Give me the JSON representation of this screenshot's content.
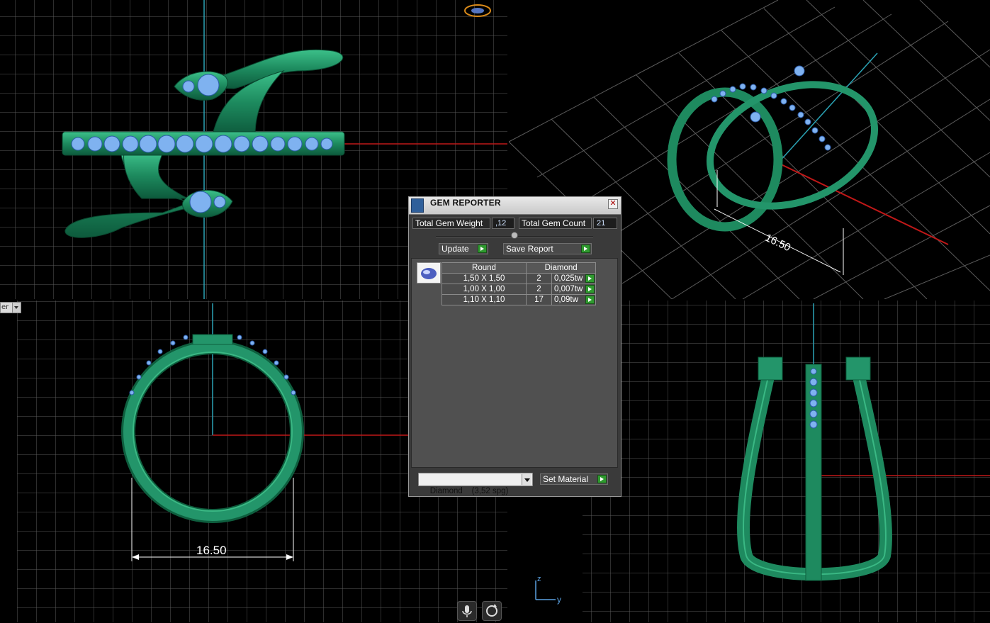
{
  "viewports": {
    "bottom_left_dimension": "16.50",
    "top_right_dimension": "16.50",
    "axis_x_label": "y",
    "axis_z_label": "z",
    "view_selector": "er"
  },
  "dialog": {
    "title": "GEM REPORTER",
    "total_weight_label": "Total Gem Weight",
    "total_weight_value": ",12",
    "total_count_label": "Total Gem Count",
    "total_count_value": "21",
    "update_label": "Update",
    "save_report_label": "Save Report",
    "table": {
      "headers": [
        "Round",
        "Diamond"
      ],
      "rows": [
        {
          "size": "1,50 X 1,50",
          "count": "2",
          "weight": "0,025tw"
        },
        {
          "size": "1,00 X 1,00",
          "count": "2",
          "weight": "0,007tw"
        },
        {
          "size": "1,10 X 1,10",
          "count": "17",
          "weight": "0,09tw"
        }
      ]
    },
    "material_select": "Diamond    (3,52 spg)",
    "set_material_label": "Set Material"
  },
  "icons": {
    "microphone": "microphone-icon",
    "rotate": "rotate-icon",
    "gem": "gem-icon",
    "close": "close-icon"
  },
  "colors": {
    "ring_green": "#1e8a5f",
    "gem_blue": "#7fb2f0",
    "axis_red": "#c01818",
    "axis_cyan": "#2aa3b5",
    "grid": "#6a6a6a",
    "go_button": "#2f9a2f"
  }
}
